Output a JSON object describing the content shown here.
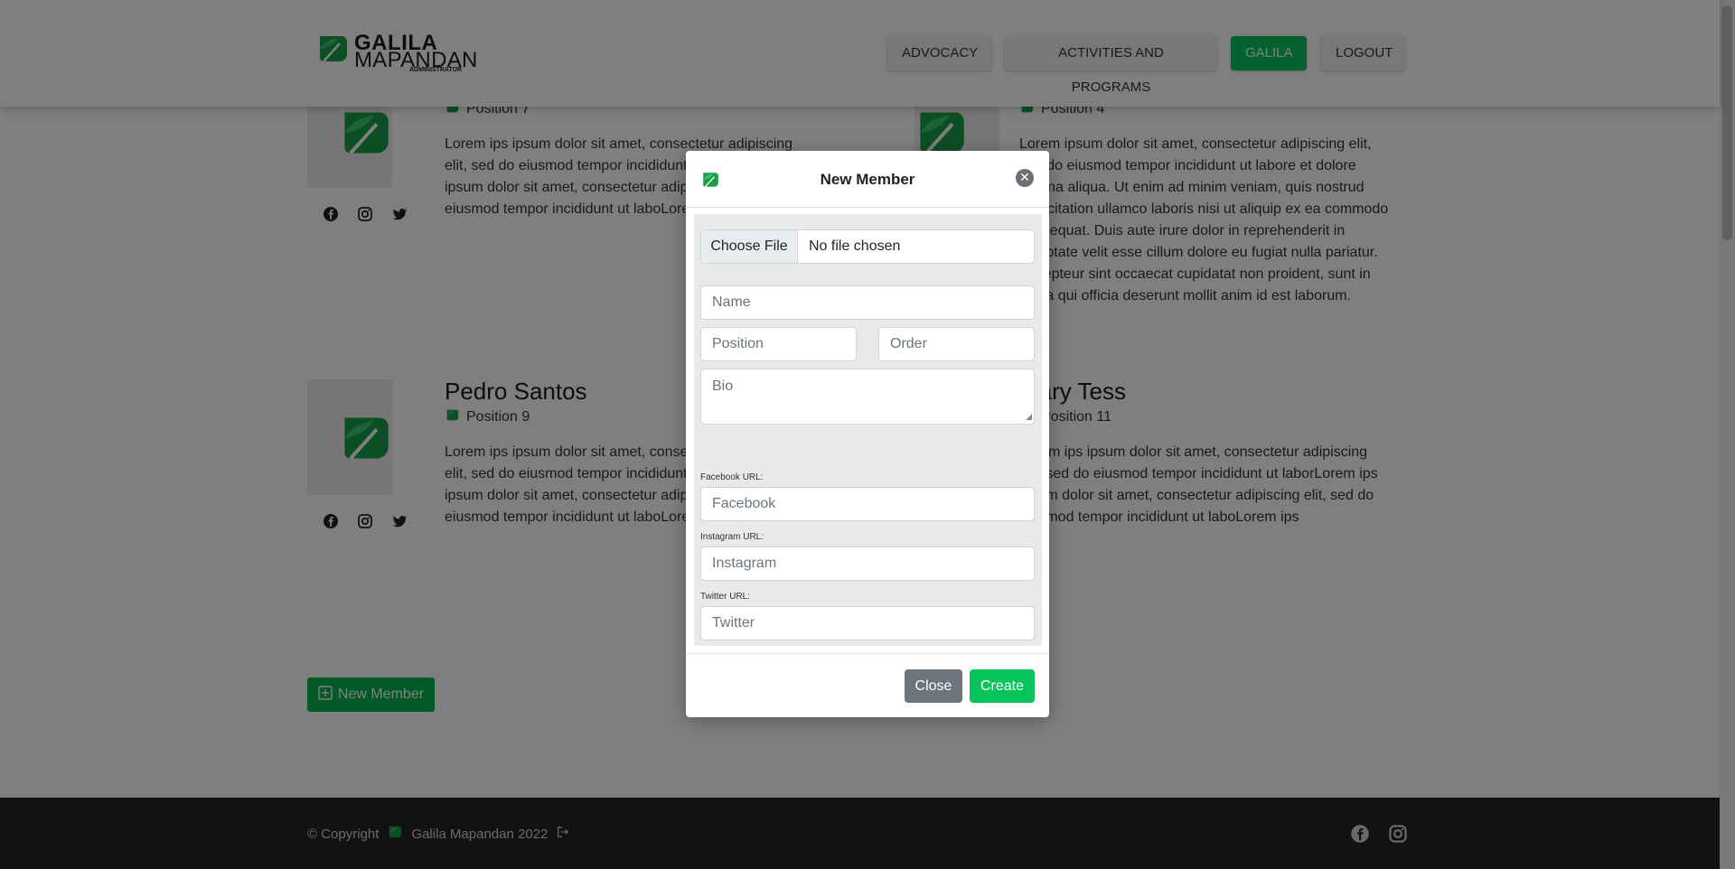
{
  "brand": {
    "line1": "GALILA",
    "line2": "MAPANDAN",
    "sub": "ADMINISTRATOR"
  },
  "nav": {
    "items": [
      {
        "label": "ADVOCACY",
        "active": false
      },
      {
        "label": "ACTIVITIES AND PROGRAMS",
        "active": false
      },
      {
        "label": "GALILA",
        "active": true
      },
      {
        "label": "LOGOUT",
        "active": false
      }
    ]
  },
  "members": [
    {
      "name": "",
      "position": "Position 7",
      "bio": "Lorem ips ipsum dolor sit amet, consectetur adipiscing elit, sed do eiusmod tempor incididunt ut laborLorem ips ipsum dolor sit amet, consectetur adipiscing elit, sed do eiusmod tempor incididunt ut laboLorem ips"
    },
    {
      "name": "",
      "position": "Position 4",
      "bio": "Lorem ipsum dolor sit amet, consectetur adipiscing elit, sed do eiusmod tempor incididunt ut labore et dolore magna aliqua. Ut enim ad minim veniam, quis nostrud exercitation ullamco laboris nisi ut aliquip ex ea commodo consequat. Duis aute irure dolor in reprehenderit in voluptate velit esse cillum dolore eu fugiat nulla pariatur. Excepteur sint occaecat cupidatat non proident, sunt in culpa qui officia deserunt mollit anim id est laborum."
    },
    {
      "name": "Pedro Santos",
      "position": "Position 9",
      "bio": "Lorem ips ipsum dolor sit amet, consectetur adipiscing elit, sed do eiusmod tempor incididunt ut laborLorem ips ipsum dolor sit amet, consectetur adipiscing elit, sed do eiusmod tempor incididunt ut laboLorem ips"
    },
    {
      "name": "Mary Tess",
      "position": "Position 11",
      "bio": "Lorem ips ipsum dolor sit amet, consectetur adipiscing elit, sed do eiusmod tempor incididunt ut laborLorem ips ipsum dolor sit amet, consectetur adipiscing elit, sed do eiusmod tempor incididunt ut laboLorem ips"
    }
  ],
  "new_member_button": "New Member",
  "footer": {
    "copyright": "© Copyright",
    "org": "Galila Mapandan 2022"
  },
  "modal": {
    "title": "New Member",
    "file": {
      "button": "Choose File",
      "status": "No file chosen"
    },
    "placeholders": {
      "name": "Name",
      "position": "Position",
      "order": "Order",
      "bio": "Bio",
      "facebook": "Facebook",
      "instagram": "Instagram",
      "twitter": "Twitter"
    },
    "labels": {
      "facebook": "Facebook URL:",
      "instagram": "Instagram URL:",
      "twitter": "Twitter URL:"
    },
    "close_button": "Close",
    "create_button": "Create"
  },
  "colors": {
    "accent": "#06c45a",
    "footer_bg": "#222428",
    "secondary": "#6c757d"
  },
  "icons": [
    "leaf-logo-icon",
    "facebook-icon",
    "instagram-icon",
    "twitter-icon",
    "close-icon",
    "plus-square-icon",
    "logout-icon"
  ]
}
